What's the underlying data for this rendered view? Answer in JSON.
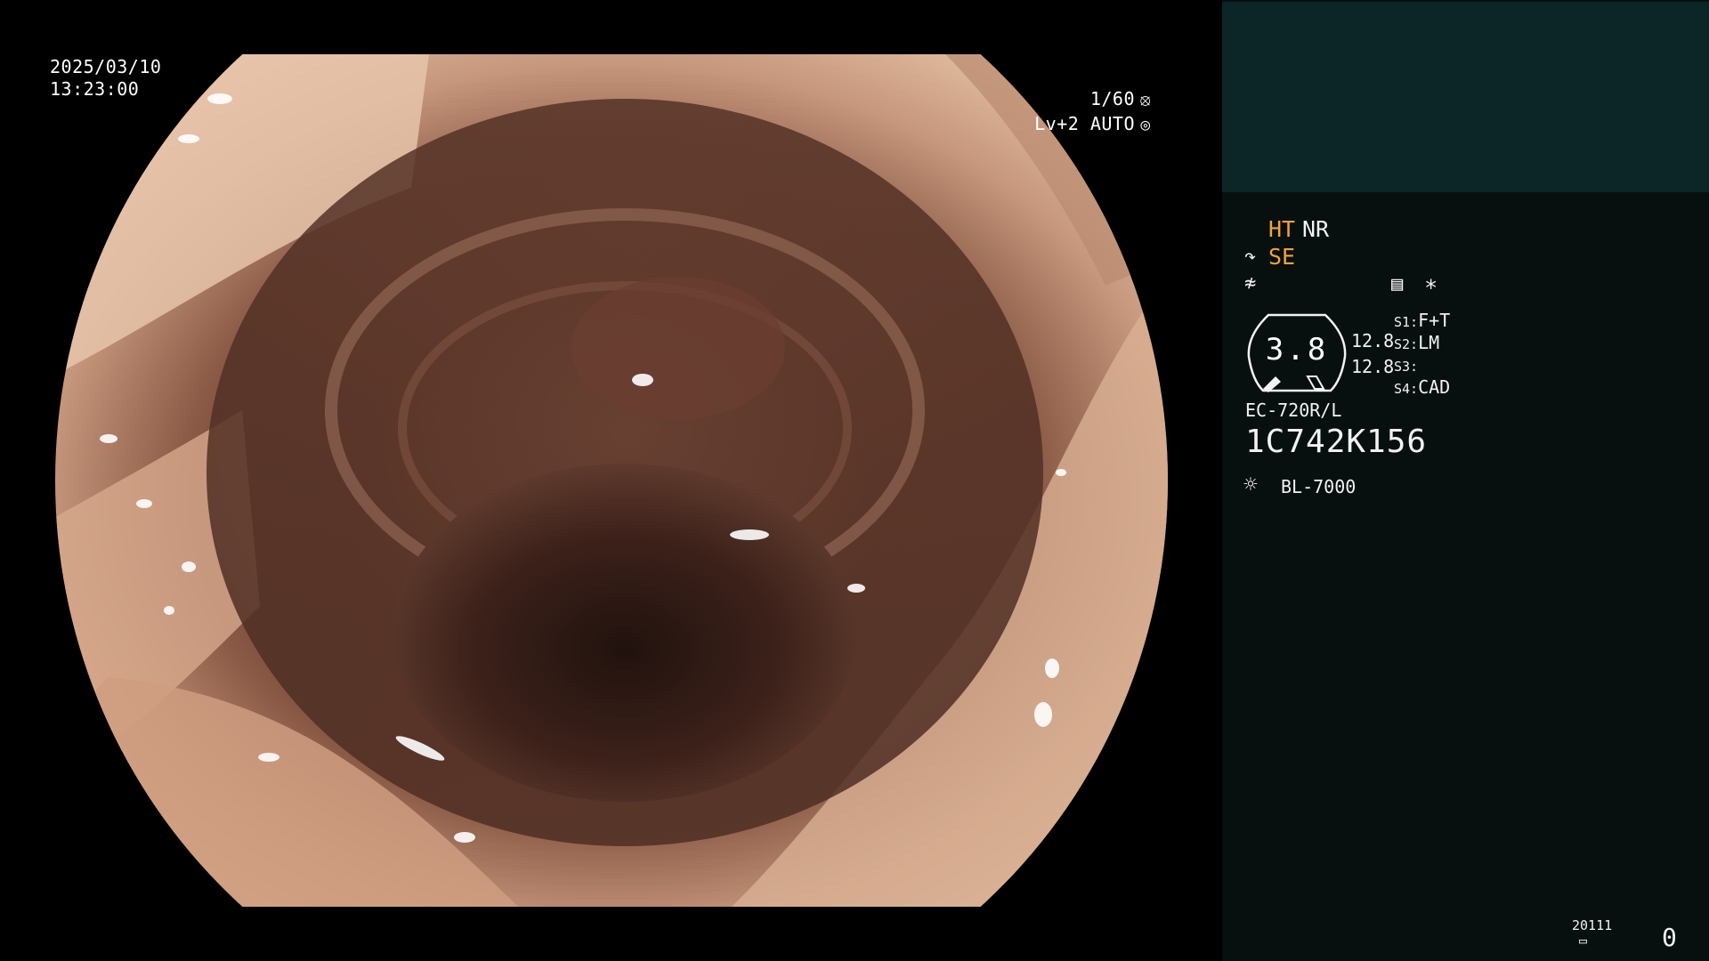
{
  "view": {
    "date": "2025/03/10",
    "time": "13:23:00",
    "shutter": "1/60",
    "iris": "Lv+2 AUTO",
    "icons": {
      "shutter": "aperture-icon",
      "iris": "iris-mode-icon"
    },
    "colors": {
      "mucosa_light": "#e8c3a6",
      "mucosa_mid": "#a9735a",
      "lumen_dark": "#2a1712"
    }
  },
  "panel": {
    "colors": {
      "patient_box": "#0c2526",
      "background": "#070f0f",
      "accent": "#f2a33a"
    },
    "modes": {
      "ht": "HT",
      "nr": "NR",
      "se": "SE"
    },
    "icons": {
      "se": "structure-enhance-icon",
      "enhance": "edge-enhance-icon",
      "memory": "memory-card-icon",
      "star": "asterisk-icon",
      "light": "lamp-icon",
      "disk": "disk-icon"
    },
    "gauge": {
      "value": "3.8",
      "icon": "scope-tip-gauge-icon"
    },
    "values": [
      "12.8",
      "12.8"
    ],
    "switches": [
      {
        "key": "S1:",
        "value": "F+T"
      },
      {
        "key": "S2:",
        "value": "LM"
      },
      {
        "key": "S3:",
        "value": ""
      },
      {
        "key": "S4:",
        "value": "CAD"
      }
    ],
    "scope": {
      "model": "EC-720R/L",
      "serial": "1C742K156"
    },
    "light_source": "BL-7000",
    "counter_small": "20111",
    "counter_main": "0"
  }
}
